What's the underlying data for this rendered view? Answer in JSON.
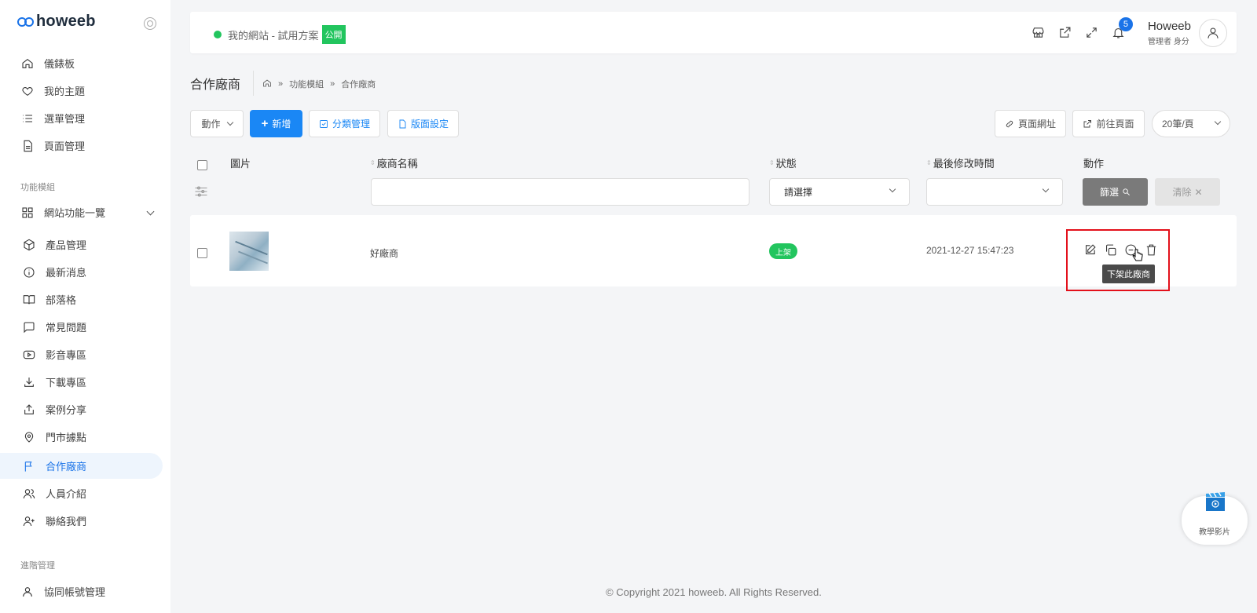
{
  "brand": {
    "name": "howeeb"
  },
  "sidebar": {
    "main_items": [
      {
        "label": "儀錶板",
        "icon": "home-icon"
      },
      {
        "label": "我的主題",
        "icon": "heart-icon"
      },
      {
        "label": "選單管理",
        "icon": "list-icon"
      },
      {
        "label": "頁面管理",
        "icon": "document-icon"
      }
    ],
    "section_modules": "功能模組",
    "module_group": {
      "label": "網站功能一覽",
      "icon": "grid-icon"
    },
    "module_items": [
      {
        "label": "產品管理",
        "icon": "box-icon"
      },
      {
        "label": "最新消息",
        "icon": "info-icon"
      },
      {
        "label": "部落格",
        "icon": "book-icon"
      },
      {
        "label": "常見問題",
        "icon": "message-icon"
      },
      {
        "label": "影音專區",
        "icon": "video-icon"
      },
      {
        "label": "下載專區",
        "icon": "download-icon"
      },
      {
        "label": "案例分享",
        "icon": "share-icon"
      },
      {
        "label": "門市據點",
        "icon": "map-pin-icon"
      },
      {
        "label": "合作廠商",
        "icon": "flag-icon",
        "active": true
      },
      {
        "label": "人員介紹",
        "icon": "users-icon"
      },
      {
        "label": "聯絡我們",
        "icon": "user-plus-icon"
      }
    ],
    "section_advanced": "進階管理",
    "advanced_items": [
      {
        "label": "協同帳號管理",
        "icon": "user-icon"
      }
    ]
  },
  "topbar": {
    "site_name": "我的網站 - 試用方案",
    "public_badge": "公開",
    "notification_count": "5",
    "user_name": "Howeeb",
    "user_role": "管理者 身分",
    "status_color": "#22c55e"
  },
  "page": {
    "title": "合作廠商",
    "breadcrumb": [
      "功能模組",
      "合作廠商"
    ]
  },
  "toolbar": {
    "action_label": "動作",
    "add_label": "新增",
    "category_label": "分類管理",
    "layout_label": "版面設定",
    "page_url_label": "頁面網址",
    "goto_page_label": "前往頁面",
    "per_page_label": "20筆/頁"
  },
  "table": {
    "headers": {
      "image": "圖片",
      "name": "廠商名稱",
      "status": "狀態",
      "modified": "最後修改時間",
      "actions": "動作"
    },
    "filters": {
      "status_placeholder": "請選擇",
      "filter_button": "篩選",
      "clear_button": "清除"
    },
    "rows": [
      {
        "name": "好廠商",
        "status": "上架",
        "modified": "2021-12-27 15:47:23"
      }
    ],
    "tooltip": "下架此廠商"
  },
  "footer": {
    "copyright": "© Copyright 2021 howeeb. All Rights Reserved."
  },
  "help": {
    "label": "教學影片"
  },
  "colors": {
    "accent": "#1a87f5",
    "success": "#22c55e",
    "highlight": "#e3101b"
  }
}
